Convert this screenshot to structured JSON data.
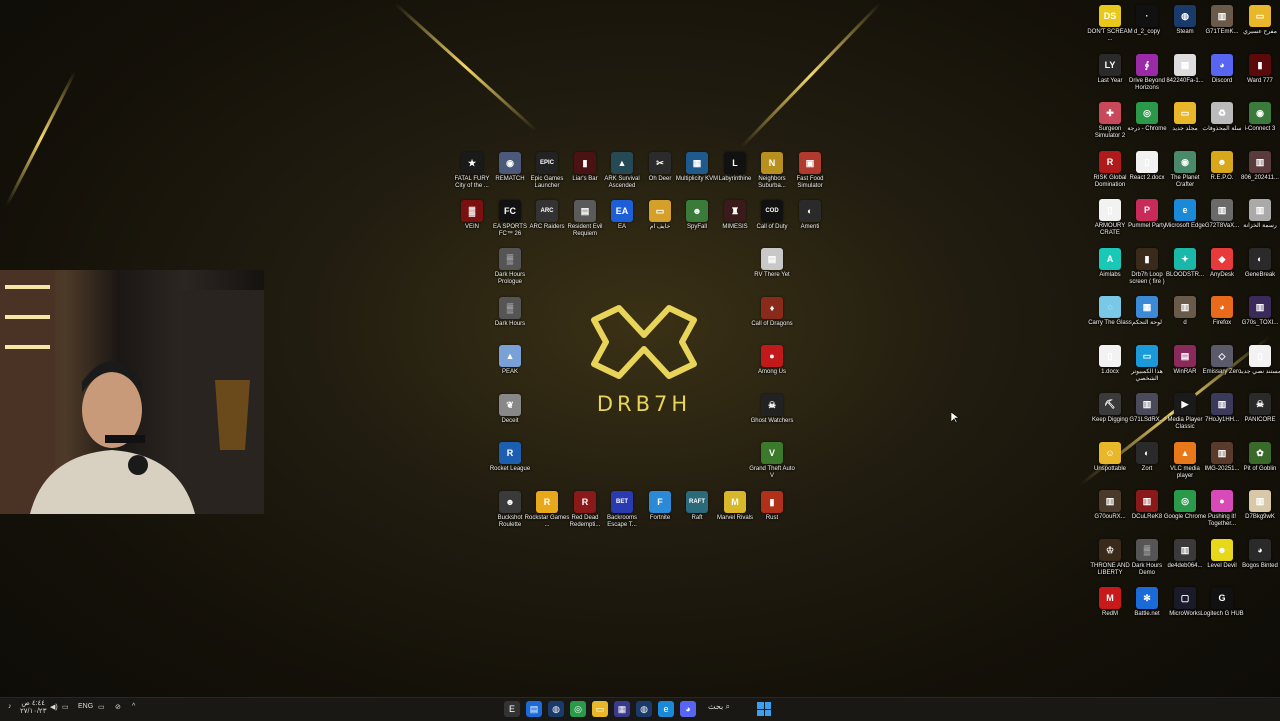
{
  "logo": {
    "text": "DRB7H",
    "accent": "#e8d458"
  },
  "icons": [
    {
      "label": "FATAL FURY City of the ...",
      "color": "#1a1a1a",
      "glyph": "★"
    },
    {
      "label": "REMATCH",
      "color": "#4b5a7a",
      "glyph": "◉"
    },
    {
      "label": "Epic Games Launcher",
      "color": "#222",
      "glyph": "EPIC"
    },
    {
      "label": "Liar's Bar",
      "color": "#4a1212",
      "glyph": "▮"
    },
    {
      "label": "ARK Survival Ascended",
      "color": "#254a55",
      "glyph": "▲"
    },
    {
      "label": "Oh Deer",
      "color": "#2b2b2b",
      "glyph": "✂"
    },
    {
      "label": "Multiplicity KVM",
      "color": "#1f5a8c",
      "glyph": "▦"
    },
    {
      "label": "Labyrinthine",
      "color": "#111",
      "glyph": "L"
    },
    {
      "label": "Neighbors Suburba...",
      "color": "#b8901e",
      "glyph": "N"
    },
    {
      "label": "Fast Food Simulator",
      "color": "#b03a2e",
      "glyph": "▣"
    },
    {
      "label": "VEIN",
      "color": "#7a1010",
      "glyph": "▓"
    },
    {
      "label": "EA SPORTS FC™ 26",
      "color": "#111",
      "glyph": "FC"
    },
    {
      "label": "ARC Raiders",
      "color": "#333",
      "glyph": "ARC"
    },
    {
      "label": "Resident Evil Requiem",
      "color": "#5a5a5a",
      "glyph": "▤"
    },
    {
      "label": "EA",
      "color": "#1e5fd8",
      "glyph": "EA"
    },
    {
      "label": "خايف ام",
      "color": "#d4a02a",
      "glyph": "▭"
    },
    {
      "label": "SpyFall",
      "color": "#3a7a3a",
      "glyph": "☻"
    },
    {
      "label": "MIMESIS",
      "color": "#3a1a1a",
      "glyph": "♜"
    },
    {
      "label": "Call of Duty",
      "color": "#111",
      "glyph": "COD"
    },
    {
      "label": "Amenti",
      "color": "#2a2a2a",
      "glyph": "◐"
    },
    {
      "label": "Dark Hours Prologue",
      "color": "#555",
      "glyph": "▒"
    },
    {
      "label": "RV There Yet",
      "color": "#c8c8c8",
      "glyph": "▤"
    },
    {
      "label": "Dark Hours",
      "color": "#555",
      "glyph": "▒"
    },
    {
      "label": "Call of Dragons",
      "color": "#8a2a1a",
      "glyph": "♦"
    },
    {
      "label": "PEAK",
      "color": "#7aa0d8",
      "glyph": "▲"
    },
    {
      "label": "Among Us",
      "color": "#c21a1a",
      "glyph": "●"
    },
    {
      "label": "Deceit",
      "color": "#888",
      "glyph": "❦"
    },
    {
      "label": "Ghost Watchers",
      "color": "#222",
      "glyph": "☠"
    },
    {
      "label": "Rocket League",
      "color": "#1c5fb0",
      "glyph": "R"
    },
    {
      "label": "Grand Theft Auto V",
      "color": "#3a7a2a",
      "glyph": "V"
    },
    {
      "label": "Buckshot Roulette",
      "color": "#3a3a3a",
      "glyph": "☻"
    },
    {
      "label": "Rockstar Games ...",
      "color": "#e8a81a",
      "glyph": "R"
    },
    {
      "label": "Red Dead Redempti...",
      "color": "#8a1a1a",
      "glyph": "R"
    },
    {
      "label": "Backrooms Escape T...",
      "color": "#2a3ab0",
      "glyph": "BET"
    },
    {
      "label": "Fortnite",
      "color": "#2a8ad8",
      "glyph": "F"
    },
    {
      "label": "Raft",
      "color": "#2a6a7a",
      "glyph": "RAFT"
    },
    {
      "label": "Marvel Rivals",
      "color": "#d8b82a",
      "glyph": "M"
    },
    {
      "label": "Rust",
      "color": "#b0301a",
      "glyph": "▮"
    },
    {
      "label": "DON'T SCREAM ...",
      "color": "#e8c81a",
      "glyph": "DS"
    },
    {
      "label": "d_2_copy",
      "color": "#111",
      "glyph": "·"
    },
    {
      "label": "Steam",
      "color": "#1a3a6a",
      "glyph": "◍"
    },
    {
      "label": "G71TEmK...",
      "color": "#6a5a4a",
      "glyph": "▥"
    },
    {
      "label": "مفرح عسيري",
      "color": "#e8b82a",
      "glyph": "▭"
    },
    {
      "label": "Last Year",
      "color": "#2a2a2a",
      "glyph": "LY"
    },
    {
      "label": "Drive Beyond Horizons",
      "color": "#9a2aa8",
      "glyph": "∮"
    },
    {
      "label": "842240Fa-1...",
      "color": "#ddd",
      "glyph": "▦"
    },
    {
      "label": "Discord",
      "color": "#5865f2",
      "glyph": "◕"
    },
    {
      "label": "Ward 777",
      "color": "#5a0a0a",
      "glyph": "▮"
    },
    {
      "label": "Surgeon Simulator 2",
      "color": "#c84a5a",
      "glyph": "✚"
    },
    {
      "label": "درجة - Chrome",
      "color": "#2a9a4a",
      "glyph": "◎"
    },
    {
      "label": "مجلد جديد",
      "color": "#e8b82a",
      "glyph": "▭"
    },
    {
      "label": "سلة المحذوفات",
      "color": "#bbb",
      "glyph": "♻"
    },
    {
      "label": "i-Connect 3",
      "color": "#3a7a3a",
      "glyph": "◉"
    },
    {
      "label": "RISK Global Domination",
      "color": "#b01a1a",
      "glyph": "R"
    },
    {
      "label": "React 2.docx",
      "color": "#f2f2f2",
      "glyph": "▯"
    },
    {
      "label": "The Planet Crafter",
      "color": "#4a8a6a",
      "glyph": "◉"
    },
    {
      "label": "R.E.P.O.",
      "color": "#d8a81a",
      "glyph": "☻"
    },
    {
      "label": "806_202411...",
      "color": "#5a3a3a",
      "glyph": "▥"
    },
    {
      "label": "ARMOURY CRATE",
      "color": "#f2f2f2",
      "glyph": "▯"
    },
    {
      "label": "Pummel Party",
      "color": "#c82a5a",
      "glyph": "P"
    },
    {
      "label": "Microsoft Edge",
      "color": "#1a8ad8",
      "glyph": "e"
    },
    {
      "label": "G72T8VaX...",
      "color": "#6a6a6a",
      "glyph": "▥"
    },
    {
      "label": "رسمة الخزانة",
      "color": "#aaa",
      "glyph": "▥"
    },
    {
      "label": "Aimlabs",
      "color": "#1ac8b8",
      "glyph": "A"
    },
    {
      "label": "Drb7h Loop screen ( fire )",
      "color": "#3a2a1a",
      "glyph": "▮"
    },
    {
      "label": "BLOODSTR...",
      "color": "#1ab8a8",
      "glyph": "✦"
    },
    {
      "label": "AnyDesk",
      "color": "#e83a3a",
      "glyph": "◆"
    },
    {
      "label": "GeneBreak",
      "color": "#2a2a2a",
      "glyph": "◐"
    },
    {
      "label": "Carry The Glass",
      "color": "#7ac8e8",
      "glyph": "◌"
    },
    {
      "label": "لوحة التحكم",
      "color": "#3a8ad8",
      "glyph": "▦"
    },
    {
      "label": "d",
      "color": "#6a5a4a",
      "glyph": "▥"
    },
    {
      "label": "Firefox",
      "color": "#e86a1a",
      "glyph": "◕"
    },
    {
      "label": "G70s_TOXI...",
      "color": "#3a2a5a",
      "glyph": "▥"
    },
    {
      "label": "1.docx",
      "color": "#f2f2f2",
      "glyph": "▯"
    },
    {
      "label": "هذا الكمبيوتر الشخصي",
      "color": "#1a9ad8",
      "glyph": "▭"
    },
    {
      "label": "WinRAR",
      "color": "#8a2a5a",
      "glyph": "▤"
    },
    {
      "label": "Emissary Zero",
      "color": "#5a5a6a",
      "glyph": "◇"
    },
    {
      "label": "مستند نصي جديد",
      "color": "#f2f2f2",
      "glyph": "▯"
    },
    {
      "label": "Keep Digging",
      "color": "#3a3a3a",
      "glyph": "⛏"
    },
    {
      "label": "G71LSdRX...",
      "color": "#4a4a5a",
      "glyph": "▥"
    },
    {
      "label": "Media Player Classic",
      "color": "#1a1a1a",
      "glyph": "▶"
    },
    {
      "label": "7HoJy1HH...",
      "color": "#3a3a5a",
      "glyph": "▥"
    },
    {
      "label": "PANICORE",
      "color": "#2a2a2a",
      "glyph": "☠"
    },
    {
      "label": "Unspottable",
      "color": "#e8b82a",
      "glyph": "☺"
    },
    {
      "label": "Zort",
      "color": "#2a2a2a",
      "glyph": "◐"
    },
    {
      "label": "VLC media player",
      "color": "#e8781a",
      "glyph": "▲"
    },
    {
      "label": "IMG-20251...",
      "color": "#5a3a2a",
      "glyph": "▥"
    },
    {
      "label": "Pit of Goblin",
      "color": "#3a6a2a",
      "glyph": "✿"
    },
    {
      "label": "G70ouRX...",
      "color": "#4a3a2a",
      "glyph": "▥"
    },
    {
      "label": "DCuLReK8",
      "color": "#8a1a1a",
      "glyph": "▥"
    },
    {
      "label": "Google Chrome",
      "color": "#2a9a4a",
      "glyph": "◎"
    },
    {
      "label": "Pushing it! Together...",
      "color": "#d84ab8",
      "glyph": "●"
    },
    {
      "label": "D7Bkg9wK",
      "color": "#d8c8a8",
      "glyph": "▥"
    },
    {
      "label": "THRONE AND LIBERTY",
      "color": "#3a2a1a",
      "glyph": "♔"
    },
    {
      "label": "Dark Hours Demo",
      "color": "#555",
      "glyph": "▒"
    },
    {
      "label": "de4deb064...",
      "color": "#3a3a3a",
      "glyph": "▥"
    },
    {
      "label": "Level Devil",
      "color": "#e8d81a",
      "glyph": "☻"
    },
    {
      "label": "Bogos Binted",
      "color": "#2a2a2a",
      "glyph": "◕"
    },
    {
      "label": "RedM",
      "color": "#c81a1a",
      "glyph": "M"
    },
    {
      "label": "Battle.net",
      "color": "#1a6ad8",
      "glyph": "✻"
    },
    {
      "label": "MicroWorks",
      "color": "#1a1a2a",
      "glyph": "▢"
    },
    {
      "label": "Logitech G HUB",
      "color": "#111",
      "glyph": "G"
    }
  ],
  "taskbar": {
    "search_label": "بحث",
    "lang": "ENG",
    "clock_time": "٤:٤٤ ص",
    "clock_date": "٢٧/١٠/٢٣",
    "apps": [
      {
        "name": "epic-icon",
        "glyph": "E",
        "color": "#333"
      },
      {
        "name": "chat-icon",
        "glyph": "▤",
        "color": "#1a6ad8"
      },
      {
        "name": "steam-icon",
        "glyph": "◍",
        "color": "#1a3a6a"
      },
      {
        "name": "chrome-icon",
        "glyph": "◎",
        "color": "#2a9a4a"
      },
      {
        "name": "folder-icon",
        "glyph": "▭",
        "color": "#e8b82a"
      },
      {
        "name": "store-icon",
        "glyph": "▦",
        "color": "#3a3a8a"
      },
      {
        "name": "steam2-icon",
        "glyph": "◍",
        "color": "#1a3a6a"
      },
      {
        "name": "edge-icon",
        "glyph": "e",
        "color": "#1a8ad8"
      },
      {
        "name": "discord-icon",
        "glyph": "◕",
        "color": "#5865f2"
      }
    ]
  }
}
